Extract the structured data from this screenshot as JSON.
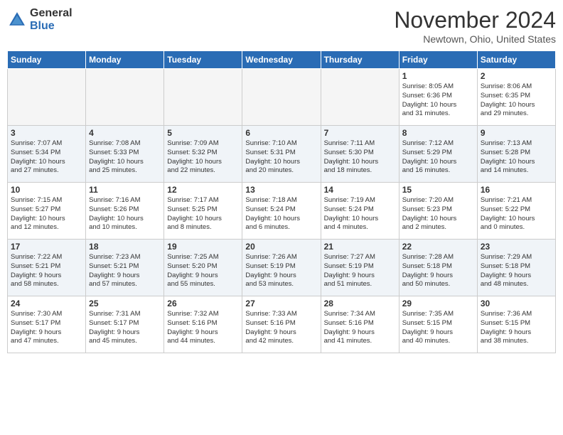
{
  "logo": {
    "general": "General",
    "blue": "Blue"
  },
  "title": "November 2024",
  "location": "Newtown, Ohio, United States",
  "days_of_week": [
    "Sunday",
    "Monday",
    "Tuesday",
    "Wednesday",
    "Thursday",
    "Friday",
    "Saturday"
  ],
  "weeks": [
    [
      {
        "day": "",
        "info": ""
      },
      {
        "day": "",
        "info": ""
      },
      {
        "day": "",
        "info": ""
      },
      {
        "day": "",
        "info": ""
      },
      {
        "day": "",
        "info": ""
      },
      {
        "day": "1",
        "info": "Sunrise: 8:05 AM\nSunset: 6:36 PM\nDaylight: 10 hours\nand 31 minutes."
      },
      {
        "day": "2",
        "info": "Sunrise: 8:06 AM\nSunset: 6:35 PM\nDaylight: 10 hours\nand 29 minutes."
      }
    ],
    [
      {
        "day": "3",
        "info": "Sunrise: 7:07 AM\nSunset: 5:34 PM\nDaylight: 10 hours\nand 27 minutes."
      },
      {
        "day": "4",
        "info": "Sunrise: 7:08 AM\nSunset: 5:33 PM\nDaylight: 10 hours\nand 25 minutes."
      },
      {
        "day": "5",
        "info": "Sunrise: 7:09 AM\nSunset: 5:32 PM\nDaylight: 10 hours\nand 22 minutes."
      },
      {
        "day": "6",
        "info": "Sunrise: 7:10 AM\nSunset: 5:31 PM\nDaylight: 10 hours\nand 20 minutes."
      },
      {
        "day": "7",
        "info": "Sunrise: 7:11 AM\nSunset: 5:30 PM\nDaylight: 10 hours\nand 18 minutes."
      },
      {
        "day": "8",
        "info": "Sunrise: 7:12 AM\nSunset: 5:29 PM\nDaylight: 10 hours\nand 16 minutes."
      },
      {
        "day": "9",
        "info": "Sunrise: 7:13 AM\nSunset: 5:28 PM\nDaylight: 10 hours\nand 14 minutes."
      }
    ],
    [
      {
        "day": "10",
        "info": "Sunrise: 7:15 AM\nSunset: 5:27 PM\nDaylight: 10 hours\nand 12 minutes."
      },
      {
        "day": "11",
        "info": "Sunrise: 7:16 AM\nSunset: 5:26 PM\nDaylight: 10 hours\nand 10 minutes."
      },
      {
        "day": "12",
        "info": "Sunrise: 7:17 AM\nSunset: 5:25 PM\nDaylight: 10 hours\nand 8 minutes."
      },
      {
        "day": "13",
        "info": "Sunrise: 7:18 AM\nSunset: 5:24 PM\nDaylight: 10 hours\nand 6 minutes."
      },
      {
        "day": "14",
        "info": "Sunrise: 7:19 AM\nSunset: 5:24 PM\nDaylight: 10 hours\nand 4 minutes."
      },
      {
        "day": "15",
        "info": "Sunrise: 7:20 AM\nSunset: 5:23 PM\nDaylight: 10 hours\nand 2 minutes."
      },
      {
        "day": "16",
        "info": "Sunrise: 7:21 AM\nSunset: 5:22 PM\nDaylight: 10 hours\nand 0 minutes."
      }
    ],
    [
      {
        "day": "17",
        "info": "Sunrise: 7:22 AM\nSunset: 5:21 PM\nDaylight: 9 hours\nand 58 minutes."
      },
      {
        "day": "18",
        "info": "Sunrise: 7:23 AM\nSunset: 5:21 PM\nDaylight: 9 hours\nand 57 minutes."
      },
      {
        "day": "19",
        "info": "Sunrise: 7:25 AM\nSunset: 5:20 PM\nDaylight: 9 hours\nand 55 minutes."
      },
      {
        "day": "20",
        "info": "Sunrise: 7:26 AM\nSunset: 5:19 PM\nDaylight: 9 hours\nand 53 minutes."
      },
      {
        "day": "21",
        "info": "Sunrise: 7:27 AM\nSunset: 5:19 PM\nDaylight: 9 hours\nand 51 minutes."
      },
      {
        "day": "22",
        "info": "Sunrise: 7:28 AM\nSunset: 5:18 PM\nDaylight: 9 hours\nand 50 minutes."
      },
      {
        "day": "23",
        "info": "Sunrise: 7:29 AM\nSunset: 5:18 PM\nDaylight: 9 hours\nand 48 minutes."
      }
    ],
    [
      {
        "day": "24",
        "info": "Sunrise: 7:30 AM\nSunset: 5:17 PM\nDaylight: 9 hours\nand 47 minutes."
      },
      {
        "day": "25",
        "info": "Sunrise: 7:31 AM\nSunset: 5:17 PM\nDaylight: 9 hours\nand 45 minutes."
      },
      {
        "day": "26",
        "info": "Sunrise: 7:32 AM\nSunset: 5:16 PM\nDaylight: 9 hours\nand 44 minutes."
      },
      {
        "day": "27",
        "info": "Sunrise: 7:33 AM\nSunset: 5:16 PM\nDaylight: 9 hours\nand 42 minutes."
      },
      {
        "day": "28",
        "info": "Sunrise: 7:34 AM\nSunset: 5:16 PM\nDaylight: 9 hours\nand 41 minutes."
      },
      {
        "day": "29",
        "info": "Sunrise: 7:35 AM\nSunset: 5:15 PM\nDaylight: 9 hours\nand 40 minutes."
      },
      {
        "day": "30",
        "info": "Sunrise: 7:36 AM\nSunset: 5:15 PM\nDaylight: 9 hours\nand 38 minutes."
      }
    ]
  ]
}
